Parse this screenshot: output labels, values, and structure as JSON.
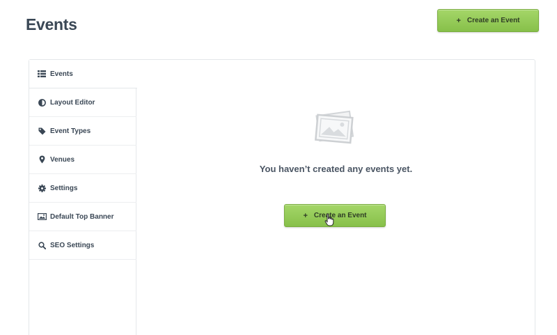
{
  "header": {
    "title": "Events",
    "create_button_plus": "+",
    "create_button_label": "Create an Event"
  },
  "sidebar": {
    "items": [
      {
        "label": "Events",
        "icon": "list-icon",
        "active": true
      },
      {
        "label": "Layout Editor",
        "icon": "contrast-icon",
        "active": false
      },
      {
        "label": "Event Types",
        "icon": "tag-icon",
        "active": false
      },
      {
        "label": "Venues",
        "icon": "map-pin-icon",
        "active": false
      },
      {
        "label": "Settings",
        "icon": "gear-icon",
        "active": false
      },
      {
        "label": "Default Top Banner",
        "icon": "image-icon",
        "active": false
      },
      {
        "label": "SEO Settings",
        "icon": "search-icon",
        "active": false
      }
    ]
  },
  "main": {
    "empty_icon": "photos-placeholder-icon",
    "empty_message": "You haven’t created any events yet.",
    "create_button_plus": "+",
    "create_button_label": "Create an Event"
  },
  "colors": {
    "button_green": "#8cc452",
    "text_dark": "#3a4755"
  }
}
